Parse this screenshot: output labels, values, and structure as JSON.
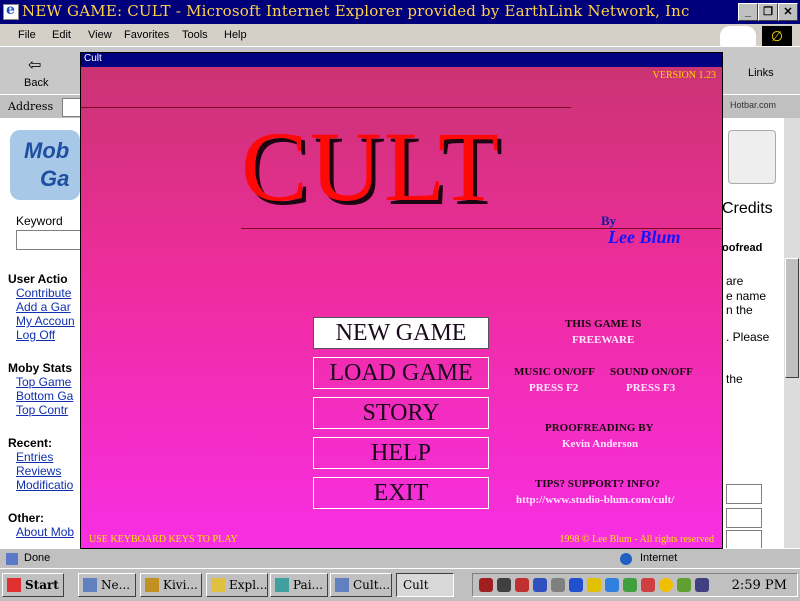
{
  "ie": {
    "title": "NEW GAME: CULT - Microsoft Internet Explorer provided by EarthLink Network, Inc",
    "menu": [
      "File",
      "Edit",
      "View",
      "Favorites",
      "Tools",
      "Help"
    ],
    "back_label": "Back",
    "address_label": "Address",
    "hotbar": "Hotbar.com",
    "links_label": "Links",
    "status": "Done",
    "zone": "Internet"
  },
  "page": {
    "logo": [
      "Mob",
      "Ga"
    ],
    "keyword_label": "Keyword",
    "sections": [
      {
        "title": "User Actio",
        "links": [
          "Contribute",
          "Add a Gar",
          "My Accoun",
          "Log Off"
        ]
      },
      {
        "title": "Moby Stats",
        "links": [
          "Top Game",
          "Bottom Ga",
          "Top Contr"
        ]
      },
      {
        "title": "Recent:",
        "links": [
          "Entries",
          "Reviews",
          "Modificatio"
        ]
      },
      {
        "title": "Other:",
        "links": [
          "About Mob"
        ]
      }
    ],
    "right": {
      "credits": "Credits",
      "proofread": "oofread",
      "lines": [
        "are",
        "e name",
        "n the",
        ". Please",
        "the"
      ]
    }
  },
  "game": {
    "window_title": "Cult",
    "version": "VERSION 1.23",
    "title": "CULT",
    "by": "By",
    "author": "Lee Blum",
    "menu": [
      "NEW GAME",
      "LOAD GAME",
      "STORY",
      "HELP",
      "EXIT"
    ],
    "selected": "NEW GAME",
    "freeware_h": "THIS GAME IS",
    "freeware_v": "FREEWARE",
    "music_h": "MUSIC ON/OFF",
    "music_v": "PRESS F2",
    "sound_h": "SOUND ON/OFF",
    "sound_v": "PRESS F3",
    "proof_h": "PROOFREADING BY",
    "proof_v": "Kevin Anderson",
    "tips_h": "TIPS? SUPPORT? INFO?",
    "tips_v": "http://www.studio-blum.com/cult/",
    "hint": "USE KEYBOARD KEYS TO PLAY",
    "copyright": "1998 © Lee Blum - All rights reserved"
  },
  "taskbar": {
    "start": "Start",
    "items": [
      "Ne...",
      "Kivi...",
      "Expl...",
      "Pai...",
      "Cult...",
      "Cult"
    ],
    "active": "Cult",
    "clock": "2:59 PM"
  },
  "colors": {
    "game_gradient_top": "#c83470",
    "game_gradient_bottom": "#f82ee4",
    "title_red": "#ff0808",
    "author_blue": "#1414ff",
    "label_yellow": "#ffe600"
  }
}
